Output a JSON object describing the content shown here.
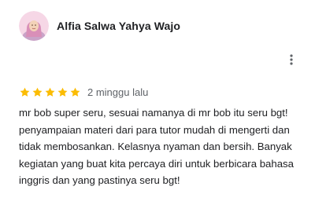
{
  "reviewer": {
    "name": "Alfia Salwa Yahya Wajo",
    "avatar": "avatar-photo"
  },
  "menu": {
    "icon": "more-vert-icon"
  },
  "review": {
    "rating": 5,
    "max_rating": 5,
    "date": "2 minggu lalu",
    "text": "mr bob super seru, sesuai namanya di mr bob itu seru bgt! penyampaian materi dari para tutor mudah di mengerti dan tidak membosankan. Kelasnya nyaman dan bersih. Banyak kegiatan yang buat kita percaya diri untuk berbicara bahasa inggris dan yang pastinya seru bgt!"
  },
  "colors": {
    "star": "#fbbc04",
    "avatar_bg": "#f6d7e6",
    "hijab": "#d98fb8"
  }
}
